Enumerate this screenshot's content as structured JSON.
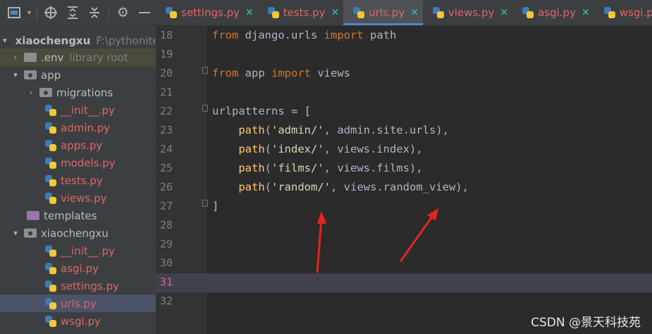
{
  "toolbar": {
    "icons": [
      "project-icon",
      "target-icon",
      "expand-all-icon",
      "collapse-all-icon",
      "gear-icon",
      "minimize-icon"
    ]
  },
  "project": {
    "root_name": "xiaochengxu",
    "root_path": "F:\\pythoniter",
    "items": [
      {
        "label": ".env",
        "meta": "library root"
      },
      {
        "label": "app"
      },
      {
        "label": "migrations"
      },
      {
        "label": "__init__.py"
      },
      {
        "label": "admin.py"
      },
      {
        "label": "apps.py"
      },
      {
        "label": "models.py"
      },
      {
        "label": "tests.py"
      },
      {
        "label": "views.py"
      },
      {
        "label": "templates"
      },
      {
        "label": "xiaochengxu"
      },
      {
        "label": "__init__.py"
      },
      {
        "label": "asgi.py"
      },
      {
        "label": "settings.py"
      },
      {
        "label": "urls.py"
      },
      {
        "label": "wsgi.py"
      }
    ]
  },
  "tabs": [
    {
      "label": "settings.py",
      "active": false
    },
    {
      "label": "tests.py",
      "active": false
    },
    {
      "label": "urls.py",
      "active": true
    },
    {
      "label": "views.py",
      "active": false
    },
    {
      "label": "asgi.py",
      "active": false
    },
    {
      "label": "wsgi.py",
      "active": false
    }
  ],
  "editor": {
    "current_line": 31,
    "lines": [
      {
        "n": "18",
        "text": "from django.urls import path"
      },
      {
        "n": "19",
        "text": ""
      },
      {
        "n": "20",
        "text": "from app import views"
      },
      {
        "n": "21",
        "text": ""
      },
      {
        "n": "22",
        "text": "urlpatterns = ["
      },
      {
        "n": "23",
        "text": "    path('admin/', admin.site.urls),"
      },
      {
        "n": "24",
        "text": "    path('index/', views.index),"
      },
      {
        "n": "25",
        "text": "    path('films/', views.films),"
      },
      {
        "n": "26",
        "text": "    path('random/', views.random_view),"
      },
      {
        "n": "27",
        "text": "]"
      },
      {
        "n": "28",
        "text": ""
      },
      {
        "n": "29",
        "text": ""
      },
      {
        "n": "30",
        "text": ""
      },
      {
        "n": "31",
        "text": ""
      },
      {
        "n": "32",
        "text": ""
      }
    ]
  },
  "watermark": "CSDN @景天科技苑",
  "colors": {
    "annotation_arrow": "#e8231e",
    "selection": "#4b5368",
    "tab_underline": "#4a88c7"
  }
}
